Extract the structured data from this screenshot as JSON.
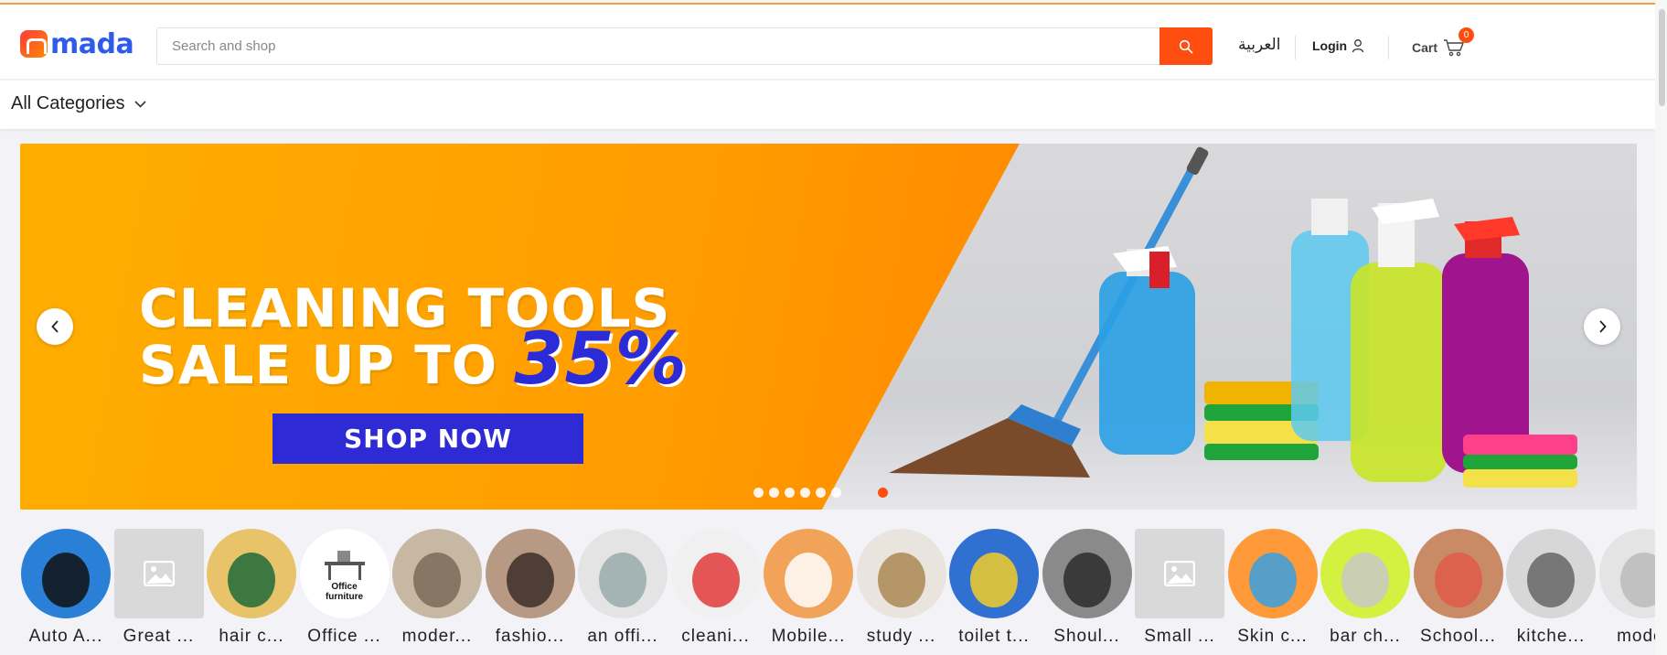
{
  "brand": {
    "logo_text": "mada",
    "accent": "#ff4d0f",
    "brand_blue": "#2f5bea"
  },
  "header": {
    "search_placeholder": "Search and shop",
    "language_label": "العربية",
    "login_label": "Login",
    "cart_label": "Cart",
    "cart_count": "0"
  },
  "category_bar": {
    "all_categories_label": "All Categories"
  },
  "hero_banner": {
    "headline_line1": "CLEANING TOOLS",
    "headline_line2": "SALE UP TO",
    "discount": "35%",
    "cta_label": "SHOP NOW",
    "slide_count": 7,
    "active_slide": 7
  },
  "categories": [
    {
      "label": "Auto A...",
      "icon": "car-accessories-image"
    },
    {
      "label": "Great ...",
      "icon": "image-placeholder-icon"
    },
    {
      "label": "hair c...",
      "icon": "hair-care-image"
    },
    {
      "label": "Office ...",
      "icon": "office-furniture-image",
      "image_caption": "Office furniture"
    },
    {
      "label": "moder...",
      "icon": "modern-chairs-image"
    },
    {
      "label": "fashio...",
      "icon": "fashion-image"
    },
    {
      "label": "an offi...",
      "icon": "office-chair-image"
    },
    {
      "label": "cleani...",
      "icon": "cleaning-tools-image"
    },
    {
      "label": "Mobile...",
      "icon": "mobile-earbuds-image"
    },
    {
      "label": "study ...",
      "icon": "study-desk-image"
    },
    {
      "label": "toilet t...",
      "icon": "toilet-tools-image"
    },
    {
      "label": "Shoul...",
      "icon": "shoulder-bag-image"
    },
    {
      "label": "Small ...",
      "icon": "image-placeholder-icon"
    },
    {
      "label": "Skin c...",
      "icon": "skin-care-image"
    },
    {
      "label": "bar ch...",
      "icon": "bar-chairs-image"
    },
    {
      "label": "School...",
      "icon": "school-furniture-image"
    },
    {
      "label": "kitche...",
      "icon": "kitchen-image"
    },
    {
      "label": "moder",
      "icon": "modern-furniture-image"
    }
  ]
}
